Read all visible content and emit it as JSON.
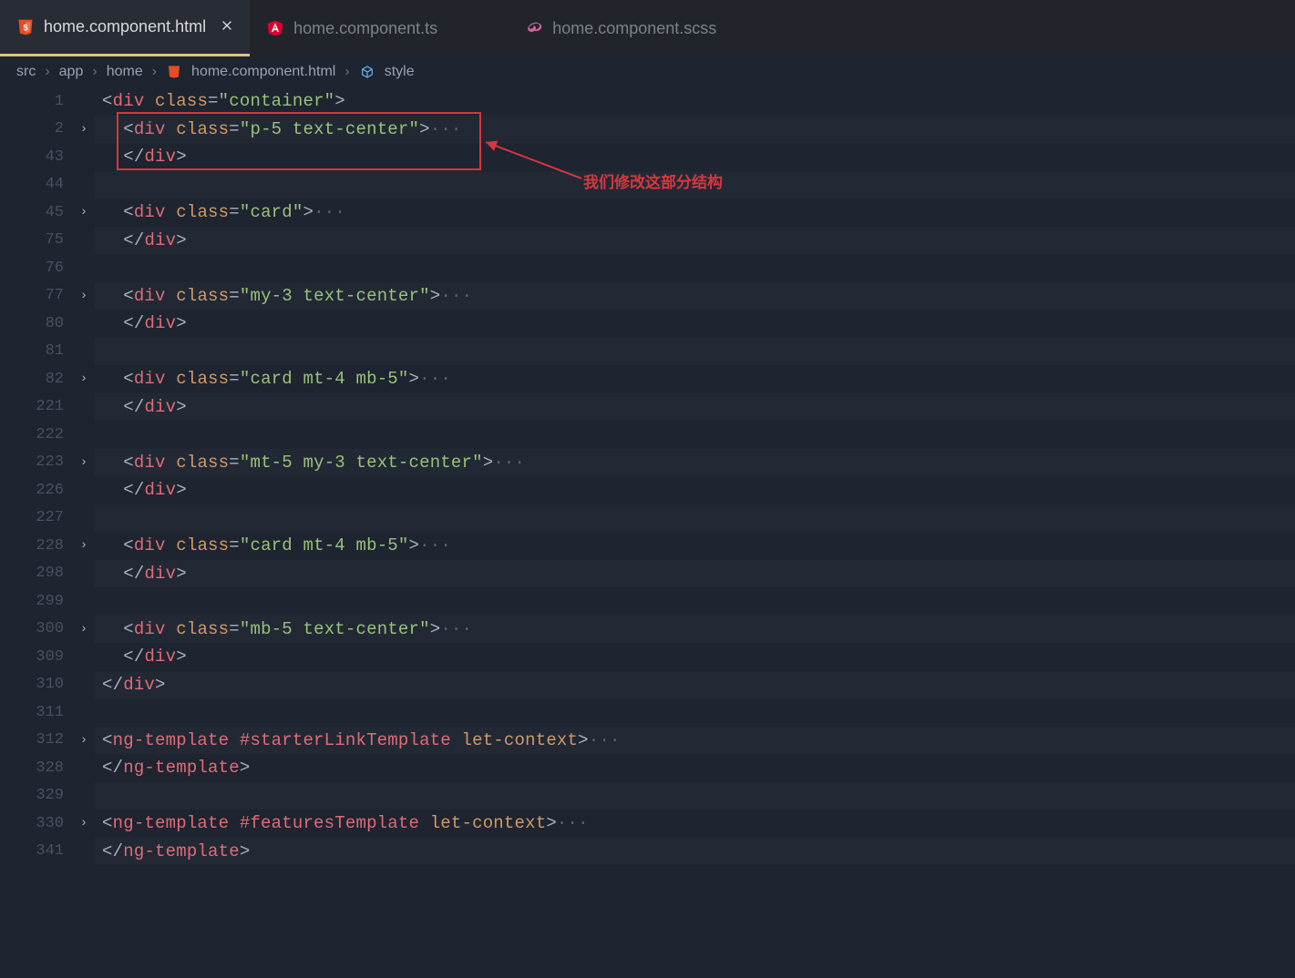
{
  "tabs": [
    {
      "label": "home.component.html",
      "icon": "html5"
    },
    {
      "label": "home.component.ts",
      "icon": "angular"
    },
    {
      "label": "home.component.scss",
      "icon": "sass"
    }
  ],
  "crumbs": {
    "c0": "src",
    "c1": "app",
    "c2": "home",
    "c3": "home.component.html",
    "c4": "style"
  },
  "annot": {
    "label": "我们修改这部分结构"
  },
  "lines": {
    "l1": "1",
    "l2": "2",
    "l43": "43",
    "l44": "44",
    "l45": "45",
    "l75": "75",
    "l76": "76",
    "l77": "77",
    "l80": "80",
    "l81": "81",
    "l82": "82",
    "l221": "221",
    "l222": "222",
    "l223": "223",
    "l226": "226",
    "l227": "227",
    "l228": "228",
    "l298": "298",
    "l299": "299",
    "l300": "300",
    "l309": "309",
    "l310": "310",
    "l311": "311",
    "l312": "312",
    "l328": "328",
    "l329": "329",
    "l330": "330",
    "l341": "341"
  },
  "tok": {
    "lt": "<",
    "lts": "</",
    "gt": ">",
    "div": "div",
    "class": "class",
    "eq": "=",
    "ngTemplate": "ng-template",
    "letContext": "let-context",
    "hashStarter": "#starterLinkTemplate",
    "hashFeatures": "#featuresTemplate",
    "dots": "···",
    "q": "\"",
    "v_container": "\"container\"",
    "v_p5": "\"p-5 text-center\"",
    "v_card": "\"card\"",
    "v_my3": "\"my-3 text-center\"",
    "v_cardmt4mb5": "\"card mt-4 mb-5\"",
    "v_mt5my3": "\"mt-5 my-3 text-center\"",
    "v_mb5": "\"mb-5 text-center\""
  }
}
